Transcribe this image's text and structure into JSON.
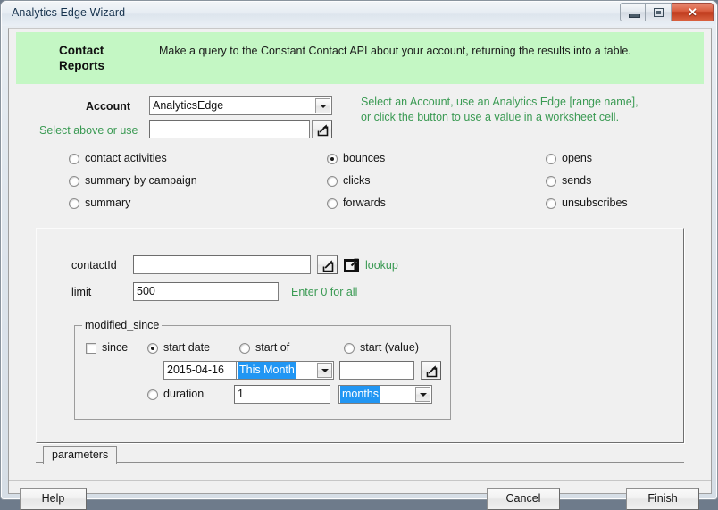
{
  "window": {
    "title": "Analytics Edge Wizard",
    "buttons": {
      "minimize": "minimize",
      "maximize": "maximize",
      "close": "✕"
    }
  },
  "header": {
    "title": "Contact\nReports",
    "title_line1": "Contact",
    "title_line2": "Reports",
    "description": "Make a query to the Constant Contact API about your account, returning the results into a table.",
    "background_color": "#c4f7c4"
  },
  "account": {
    "label": "Account",
    "combo_value": "AnalyticsEdge",
    "range_label": "Select above or use",
    "range_value": "",
    "range_placeholder": "",
    "hint_line1": "Select an Account, use an Analytics Edge [range name],",
    "hint_line2": "or click the button to use a value in a worksheet cell.",
    "hint_color": "#3a9a53"
  },
  "report_options": {
    "selected": "bounces",
    "column1": [
      {
        "id": "contact-activities",
        "label": "contact activities",
        "checked": false
      },
      {
        "id": "summary-by-campaign",
        "label": "summary by campaign",
        "checked": false
      },
      {
        "id": "summary",
        "label": "summary",
        "checked": false
      }
    ],
    "column2": [
      {
        "id": "bounces",
        "label": "bounces",
        "checked": true
      },
      {
        "id": "clicks",
        "label": "clicks",
        "checked": false
      },
      {
        "id": "forwards",
        "label": "forwards",
        "checked": false
      }
    ],
    "column3": [
      {
        "id": "opens",
        "label": "opens",
        "checked": false
      },
      {
        "id": "sends",
        "label": "sends",
        "checked": false
      },
      {
        "id": "unsubscribes",
        "label": "unsubscribes",
        "checked": false
      }
    ]
  },
  "parameters": {
    "contact_id": {
      "label": "contactId",
      "value": "",
      "lookup_label": "lookup"
    },
    "limit": {
      "label": "limit",
      "value": "500",
      "hint": "Enter 0 for all"
    },
    "modified_since": {
      "group_title": "modified_since",
      "since_label": "since",
      "since_checked": false,
      "start_date": {
        "label": "start date",
        "checked": true,
        "value": "2015-04-16"
      },
      "start_of": {
        "label": "start of",
        "checked": false,
        "value": "This Month",
        "highlighted": true
      },
      "start_value": {
        "label": "start (value)",
        "checked": false,
        "value": ""
      },
      "duration": {
        "label": "duration",
        "checked": false,
        "amount": "1",
        "unit": "months",
        "unit_highlighted": true
      }
    }
  },
  "tabs": [
    {
      "id": "parameters",
      "label": "parameters",
      "active": true
    }
  ],
  "footer": {
    "help": "Help",
    "cancel": "Cancel",
    "finish": "Finish"
  },
  "colors": {
    "header_green": "#c4f7c4",
    "hint_green": "#3a9a53",
    "selection_blue": "#2196f3",
    "dialog_face": "#f0f0f0"
  }
}
